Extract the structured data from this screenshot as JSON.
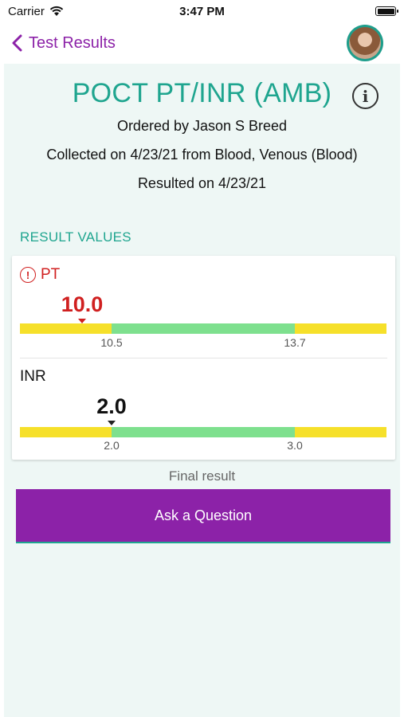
{
  "status_bar": {
    "carrier": "Carrier",
    "time": "3:47 PM"
  },
  "nav": {
    "back_label": "Test Results"
  },
  "test": {
    "title": "POCT PT/INR (AMB)",
    "ordered_by": "Ordered by Jason S Breed",
    "collected": "Collected on 4/23/21 from Blood, Venous (Blood)",
    "resulted": "Resulted on 4/23/21"
  },
  "section_label": "RESULT VALUES",
  "results": [
    {
      "name": "PT",
      "value": "10.0",
      "abnormal": true,
      "range_low": "10.5",
      "range_high": "13.7"
    },
    {
      "name": "INR",
      "value": "2.0",
      "abnormal": false,
      "range_low": "2.0",
      "range_high": "3.0"
    }
  ],
  "final_result": "Final result",
  "ask_button": "Ask a Question",
  "colors": {
    "accent_teal": "#1fa58f",
    "brand_purple": "#8c22a8",
    "alert_red": "#d02020",
    "range_normal": "#7ee08e",
    "range_out": "#f6e02a"
  }
}
